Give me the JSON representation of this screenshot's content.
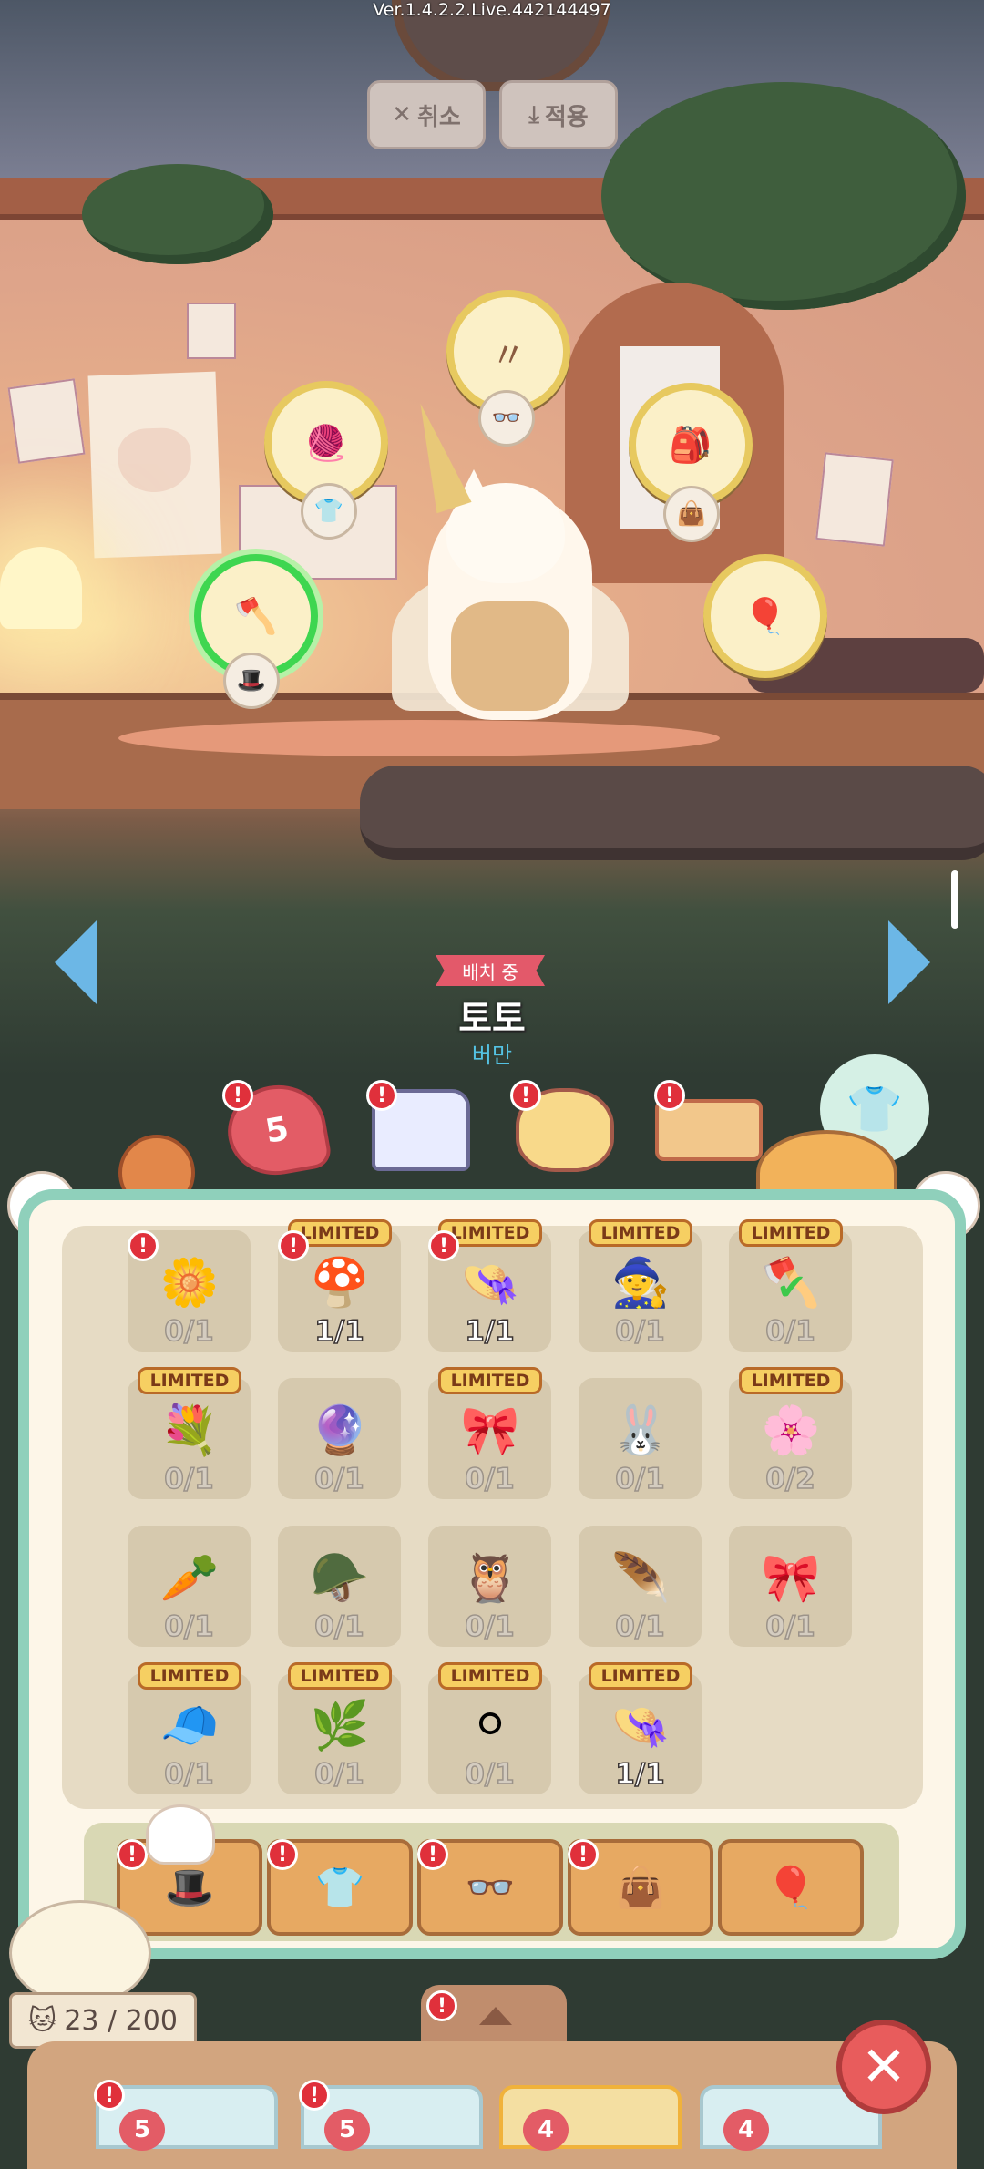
{
  "version": "Ver.1.4.2.2.Live.442144497",
  "top_buttons": {
    "cancel": {
      "label": "취소",
      "icon": "x-icon"
    },
    "apply": {
      "label": "적용",
      "icon": "download-icon"
    }
  },
  "equip_slots": [
    {
      "name": "hat",
      "icon": "hat-icon",
      "glyph": "🎩"
    },
    {
      "name": "top",
      "icon": "shirt-icon",
      "glyph": "👕"
    },
    {
      "name": "glasses",
      "icon": "glasses-icon",
      "glyph": "👓"
    },
    {
      "name": "bag",
      "icon": "bag-icon",
      "glyph": "👜"
    },
    {
      "name": "balloon",
      "icon": "balloon-icon",
      "glyph": "🎈"
    }
  ],
  "character": {
    "status_label": "배치 중",
    "name": "토토",
    "subtitle": "버만"
  },
  "tabs": [
    {
      "name": "affection",
      "value": "5",
      "badge": "!"
    },
    {
      "name": "clothes",
      "badge": "!"
    },
    {
      "name": "face",
      "badge": "!"
    },
    {
      "name": "food",
      "badge": "!"
    }
  ],
  "limited_label": "LIMITED",
  "items": [
    {
      "art": "🌼",
      "count": "0/1",
      "limited": false,
      "badge": "!",
      "owned": false
    },
    {
      "art": "🍄",
      "count": "1/1",
      "limited": true,
      "badge": "!",
      "owned": true
    },
    {
      "art": "👒",
      "count": "1/1",
      "limited": true,
      "badge": "!",
      "owned": true
    },
    {
      "art": "🧙",
      "count": "0/1",
      "limited": true,
      "badge": "",
      "owned": false
    },
    {
      "art": "🪓",
      "count": "0/1",
      "limited": true,
      "badge": "",
      "owned": false,
      "equipped": true
    },
    {
      "art": "💐",
      "count": "0/1",
      "limited": true,
      "badge": "",
      "owned": false
    },
    {
      "art": "🔮",
      "count": "0/1",
      "limited": false,
      "badge": "",
      "owned": false
    },
    {
      "art": "🎀",
      "count": "0/1",
      "limited": true,
      "badge": "",
      "owned": false
    },
    {
      "art": "🐰",
      "count": "0/1",
      "limited": false,
      "badge": "",
      "owned": false
    },
    {
      "art": "🌸",
      "count": "0/2",
      "limited": true,
      "badge": "",
      "owned": false
    },
    {
      "art": "🥕",
      "count": "0/1",
      "limited": false,
      "badge": "",
      "owned": false
    },
    {
      "art": "🪖",
      "count": "0/1",
      "limited": false,
      "badge": "",
      "owned": false
    },
    {
      "art": "🦉",
      "count": "0/1",
      "limited": false,
      "badge": "",
      "owned": false
    },
    {
      "art": "🪶",
      "count": "0/1",
      "limited": false,
      "badge": "",
      "owned": false
    },
    {
      "art": "🎀",
      "count": "0/1",
      "limited": false,
      "badge": "",
      "owned": false
    },
    {
      "art": "🧢",
      "count": "0/1",
      "limited": true,
      "badge": "",
      "owned": false
    },
    {
      "art": "🌿",
      "count": "0/1",
      "limited": true,
      "badge": "",
      "owned": false
    },
    {
      "art": "⚪",
      "count": "0/1",
      "limited": true,
      "badge": "",
      "owned": false
    },
    {
      "art": "👒",
      "count": "1/1",
      "limited": true,
      "badge": "",
      "owned": true
    }
  ],
  "categories": [
    {
      "name": "hat",
      "icon": "hat-icon",
      "glyph": "🎩",
      "badge": "!"
    },
    {
      "name": "top",
      "icon": "shirt-icon",
      "glyph": "👕",
      "badge": "!"
    },
    {
      "name": "glasses",
      "icon": "glasses-icon",
      "glyph": "👓",
      "badge": "!"
    },
    {
      "name": "bag",
      "icon": "bag-icon",
      "glyph": "👜",
      "badge": "!"
    },
    {
      "name": "balloon",
      "icon": "balloon-icon",
      "glyph": "🎈",
      "badge": ""
    }
  ],
  "cat_counter": "23 / 200",
  "bottom_tab_badge": "!",
  "roster": [
    {
      "value": "5",
      "badge": "!"
    },
    {
      "value": "5",
      "badge": "!"
    },
    {
      "value": "4",
      "badge": ""
    },
    {
      "value": "4",
      "badge": ""
    }
  ],
  "colors": {
    "accent": "#8fd0bb",
    "badge": "#e0303b",
    "limited": "#f6cf62"
  }
}
